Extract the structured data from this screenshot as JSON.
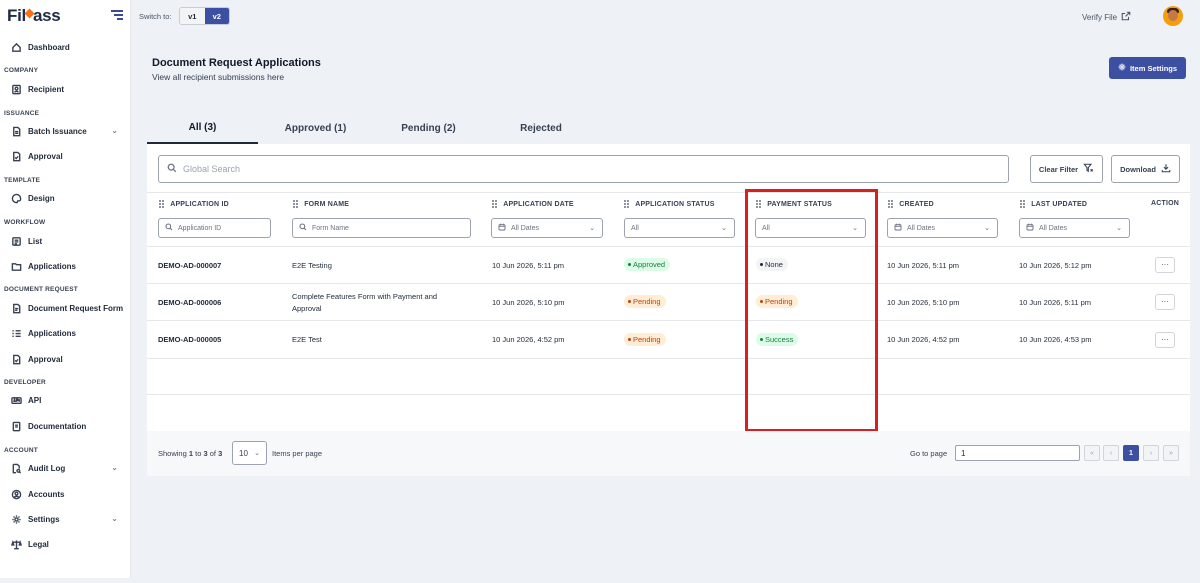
{
  "brand": {
    "logo_text_a": "Fil",
    "logo_text_b": "ass"
  },
  "topbar": {
    "switch_label": "Switch to:",
    "v1": "v1",
    "v2": "v2",
    "verify_file": "Verify File"
  },
  "sidebar": {
    "dashboard": "Dashboard",
    "company": "COMPANY",
    "recipient": "Recipient",
    "issuance": "ISSUANCE",
    "batch_issuance": "Batch Issuance",
    "approval1": "Approval",
    "template": "TEMPLATE",
    "design": "Design",
    "workflow": "WORKFLOW",
    "list": "List",
    "applications1": "Applications",
    "document_request": "DOCUMENT REQUEST",
    "document_request_form": "Document Request Form",
    "applications2": "Applications",
    "approval2": "Approval",
    "developer": "DEVELOPER",
    "api": "API",
    "documentation": "Documentation",
    "account": "ACCOUNT",
    "audit_log": "Audit Log",
    "accounts": "Accounts",
    "settings": "Settings",
    "legal": "Legal"
  },
  "page": {
    "title": "Document Request Applications",
    "subtitle": "View all recipient submissions here",
    "item_settings": "Item Settings"
  },
  "tabs": {
    "all": "All (3)",
    "approved": "Approved (1)",
    "pending": "Pending (2)",
    "rejected": "Rejected"
  },
  "toolbar": {
    "search_placeholder": "Global Search",
    "clear_filter": "Clear Filter",
    "download": "Download"
  },
  "columns": {
    "application_id": "APPLICATION ID",
    "form_name": "FORM NAME",
    "application_date": "APPLICATION DATE",
    "application_status": "APPLICATION STATUS",
    "payment_status": "PAYMENT STATUS",
    "created": "CREATED",
    "last_updated": "LAST UPDATED",
    "action": "ACTION"
  },
  "filters": {
    "application_id_placeholder": "Application ID",
    "form_name_placeholder": "Form Name",
    "application_date": "All Dates",
    "application_status": "All",
    "payment_status": "All",
    "created": "All Dates",
    "last_updated": "All Dates"
  },
  "rows": [
    {
      "id": "DEMO-AD-000007",
      "form_name": "E2E Testing",
      "form_name_line2": "",
      "application_date": "10 Jun 2026, 5:11 pm",
      "application_status": "Approved",
      "payment_status": "None",
      "created": "10 Jun 2026, 5:11 pm",
      "last_updated": "10 Jun 2026, 5:12 pm",
      "action": "···"
    },
    {
      "id": "DEMO-AD-000006",
      "form_name": "Complete Features Form with Payment and",
      "form_name_line2": "Approval",
      "application_date": "10 Jun 2026, 5:10 pm",
      "application_status": "Pending",
      "payment_status": "Pending",
      "created": "10 Jun 2026, 5:10 pm",
      "last_updated": "10 Jun 2026, 5:11 pm",
      "action": "···"
    },
    {
      "id": "DEMO-AD-000005",
      "form_name": "E2E Test",
      "form_name_line2": "",
      "application_date": "10 Jun 2026, 4:52 pm",
      "application_status": "Pending",
      "payment_status": "Success",
      "created": "10 Jun 2026, 4:52 pm",
      "last_updated": "10 Jun 2026, 4:53 pm",
      "action": "···"
    }
  ],
  "footer": {
    "showing_prefix": "Showing ",
    "from": "1",
    "to_word": " to ",
    "to": "3",
    "of_word": " of ",
    "total": "3",
    "per_page": "10",
    "items_per_page": "Items per page",
    "go_to_page": "Go to page",
    "page_value": "1",
    "current_page": "1",
    "first": "«",
    "prev": "‹",
    "next": "›",
    "last": "»"
  },
  "colors": {
    "accent": "#3d4fa3",
    "highlight": "#d91f1f",
    "approved": "#15803d",
    "pending": "#c2410c"
  }
}
